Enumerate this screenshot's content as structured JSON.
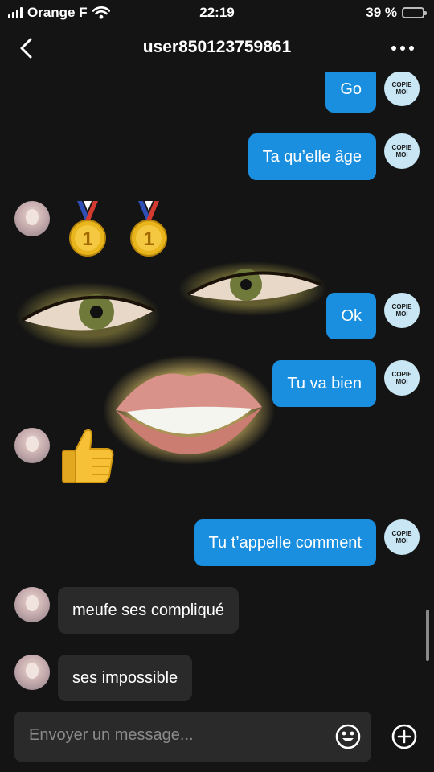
{
  "status_bar": {
    "carrier": "Orange F",
    "time": "22:19",
    "battery": "39 %",
    "battery_level": 0.39,
    "battery_color": "#f7c600"
  },
  "header": {
    "title": "user850123759861",
    "back_icon": "chevron-left-icon",
    "more_icon": "ellipsis-icon"
  },
  "my_avatar": {
    "text_line1": "COPIE",
    "text_line2": "MOI"
  },
  "messages": [
    {
      "from": "me",
      "text": "Go"
    },
    {
      "from": "me",
      "text": "Ta qu’elle âge"
    },
    {
      "from": "them",
      "sticker": "gold-medal-pair"
    },
    {
      "from": "me",
      "text": "Ok"
    },
    {
      "from": "me",
      "text": "Tu va bien"
    },
    {
      "from": "them",
      "sticker": "thumbs-up"
    },
    {
      "from": "me",
      "text": "Tu t’appelle comment"
    },
    {
      "from": "them",
      "text": "meufe ses compliqué"
    },
    {
      "from": "them",
      "text": "ses impossible"
    }
  ],
  "medal_digit": "1",
  "colors": {
    "outgoing": "#1a8fe0",
    "incoming": "#2a2a2a",
    "background": "#141414"
  },
  "input": {
    "placeholder": "Envoyer un message...",
    "emoji_icon": "smiley-icon",
    "plus_icon": "plus-circle-icon"
  }
}
